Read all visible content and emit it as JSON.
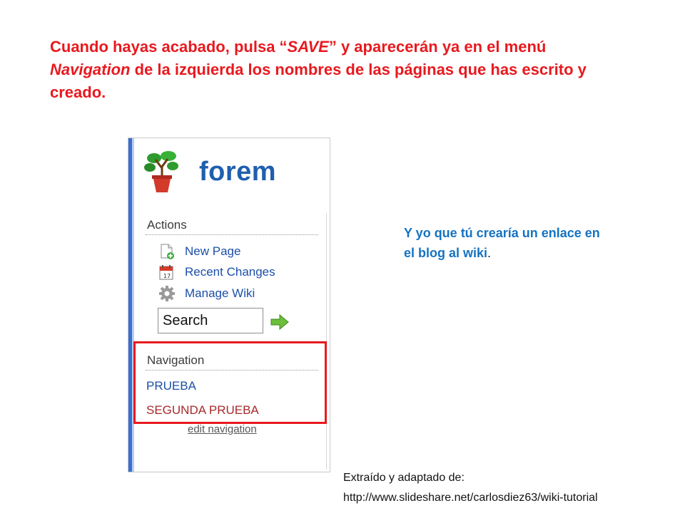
{
  "slide": {
    "instruction": {
      "part1": "Cuando hayas acabado, pulsa “",
      "save": "SAVE",
      "part2": "” y aparecerán ya en el menú ",
      "navigation": "Navigation",
      "part3": " de la izquierda los nombres de las páginas que has escrito y creado."
    },
    "tip": {
      "text": "Y yo que tú crearía un enlace en el blog al wiki",
      "end": "."
    },
    "source": {
      "line1": "Extraído y adaptado de:",
      "line2": "http://www.slideshare.net/carlosdiez63/wiki-tutorial"
    },
    "highlight_color": "#e8191f"
  },
  "wiki": {
    "logo": {
      "text": "forem",
      "icon": "potted-plant-icon"
    },
    "actions": {
      "title": "Actions",
      "items": [
        {
          "label": "New Page",
          "icon": "new-page-icon"
        },
        {
          "label": "Recent Changes",
          "icon": "calendar-icon"
        },
        {
          "label": "Manage Wiki",
          "icon": "gear-icon"
        }
      ]
    },
    "search": {
      "value": "Search",
      "go_icon": "green-arrow-icon"
    },
    "navigation": {
      "title": "Navigation",
      "links": [
        "PRUEBA",
        "SEGUNDA PRUEBA"
      ],
      "edit_label": "edit navigation"
    },
    "colors": {
      "link": "#1b4fa8",
      "accent": "#3a6fd0"
    }
  }
}
